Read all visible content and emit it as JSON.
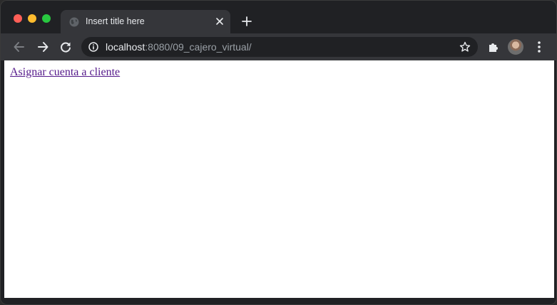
{
  "window": {
    "controls": {
      "close_color": "#ff5f57",
      "minimize_color": "#febc2e",
      "maximize_color": "#28c840"
    }
  },
  "tab": {
    "title": "Insert title here",
    "favicon": "globe-icon",
    "close_icon": "close-icon"
  },
  "new_tab_icon": "plus-icon",
  "toolbar": {
    "back_icon": "arrow-left-icon",
    "forward_icon": "arrow-right-icon",
    "reload_icon": "reload-icon",
    "url_host": "localhost",
    "url_rest": ":8080/09_cajero_virtual/",
    "info_icon": "info-icon",
    "bookmark_icon": "star-icon",
    "extensions_icon": "puzzle-icon",
    "profile_icon": "avatar",
    "menu_icon": "kebab-menu-icon"
  },
  "page": {
    "link_text": "Asignar cuenta a cliente",
    "link_color": "#551a8b"
  }
}
